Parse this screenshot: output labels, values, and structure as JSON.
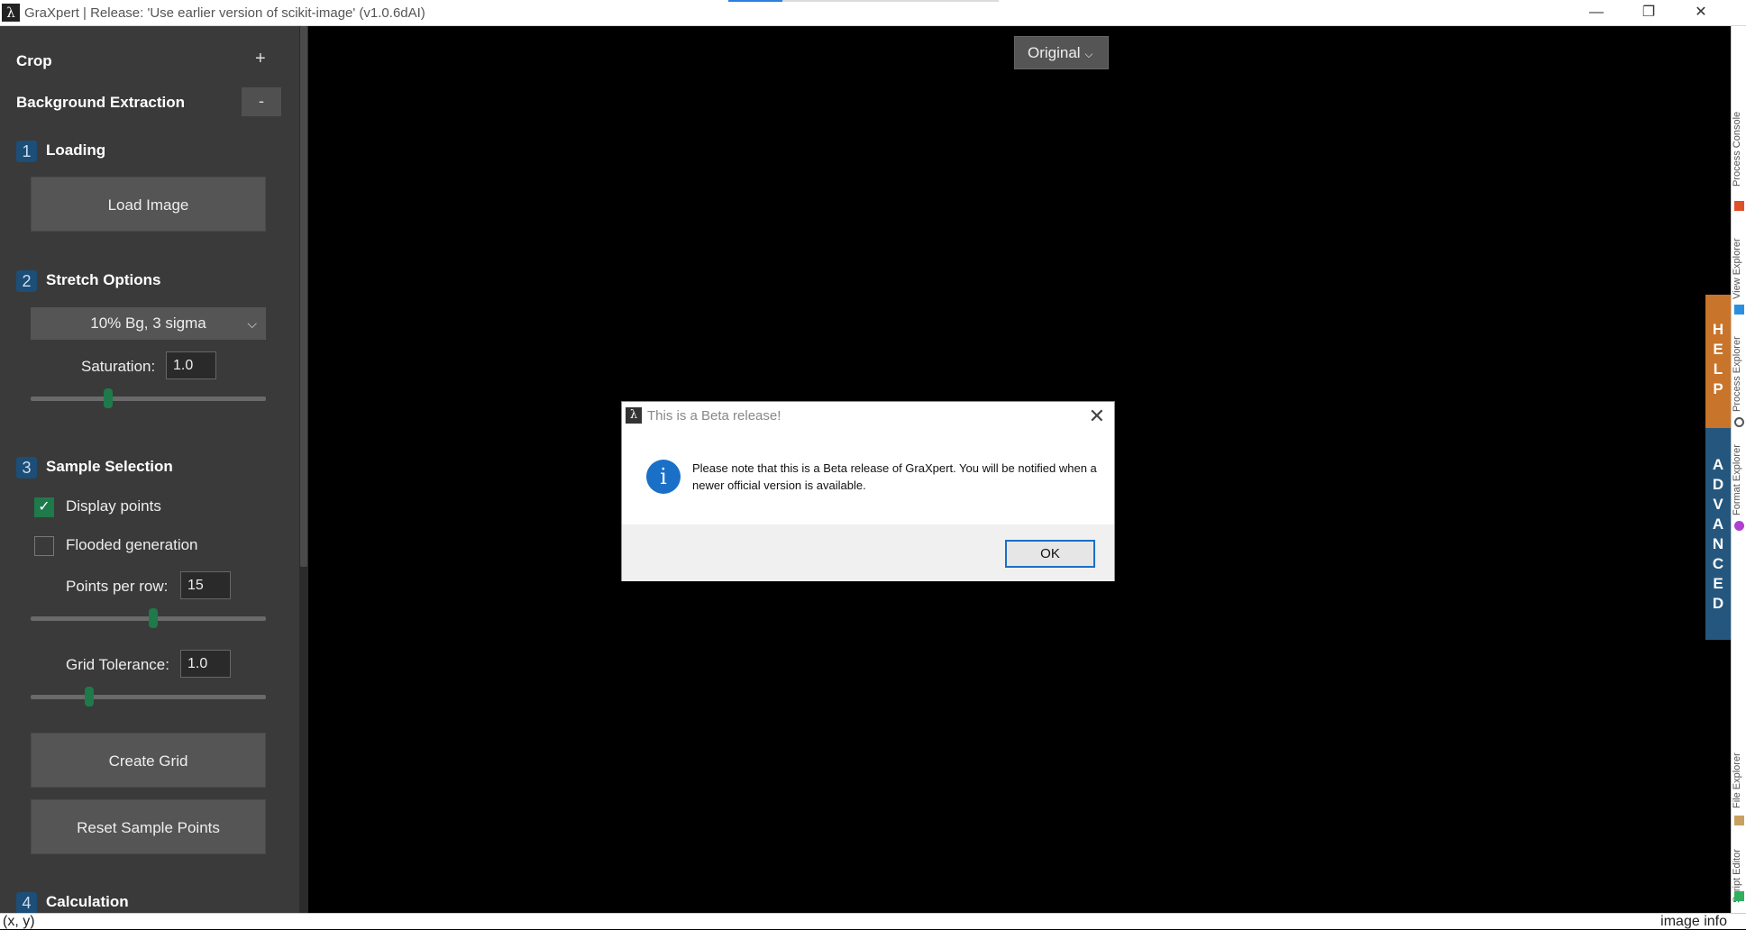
{
  "window": {
    "title": "GraXpert | Release: 'Use earlier version of scikit-image' (v1.0.6dAI)",
    "app_icon_glyph": "λ",
    "minimize": "—",
    "maximize": "❐",
    "close": "✕"
  },
  "left_panel": {
    "crop": {
      "label": "Crop",
      "toggle": "+"
    },
    "background_extraction": {
      "label": "Background Extraction",
      "toggle": "-"
    },
    "loading": {
      "step": "1",
      "title": "Loading",
      "load_button": "Load Image"
    },
    "stretch": {
      "step": "2",
      "title": "Stretch Options",
      "selected": "10% Bg, 3 sigma",
      "saturation_label": "Saturation:",
      "saturation_value": "1.0",
      "saturation_slider_fraction": 0.33
    },
    "sample_selection": {
      "step": "3",
      "title": "Sample Selection",
      "display_points_label": "Display points",
      "display_points_checked": true,
      "flooded_label": "Flooded generation",
      "flooded_checked": false,
      "points_per_row_label": "Points per row:",
      "points_per_row_value": "15",
      "points_per_row_slider_fraction": 0.52,
      "grid_tolerance_label": "Grid Tolerance:",
      "grid_tolerance_value": "1.0",
      "grid_tolerance_slider_fraction": 0.25,
      "create_grid_button": "Create Grid",
      "reset_points_button": "Reset Sample Points"
    },
    "calculation": {
      "step": "4",
      "title": "Calculation"
    }
  },
  "canvas": {
    "view_select": "Original",
    "view_chevron": "⌵"
  },
  "side_tabs": {
    "help_letters": [
      "H",
      "E",
      "L",
      "P"
    ],
    "advanced_letters": [
      "A",
      "D",
      "V",
      "A",
      "N",
      "C",
      "E",
      "D"
    ],
    "strip": [
      "Process Console",
      "View Explorer",
      "Process Explorer",
      "Format Explorer",
      "File Explorer",
      "Script Editor"
    ]
  },
  "statusbar": {
    "coords": "(x, y)",
    "info": "image info"
  },
  "dialog": {
    "title": "This is a Beta release!",
    "message": "Please note that this is a Beta release of GraXpert. You will be notified when a newer official version is available.",
    "ok": "OK",
    "info_glyph": "i",
    "close_glyph": "✕"
  },
  "colors": {
    "accent_green": "#1e7a4a",
    "step_blue": "#1c4e77",
    "help_orange": "#c8742a",
    "advanced_blue": "#25577e",
    "info_blue": "#1a6fc7"
  }
}
